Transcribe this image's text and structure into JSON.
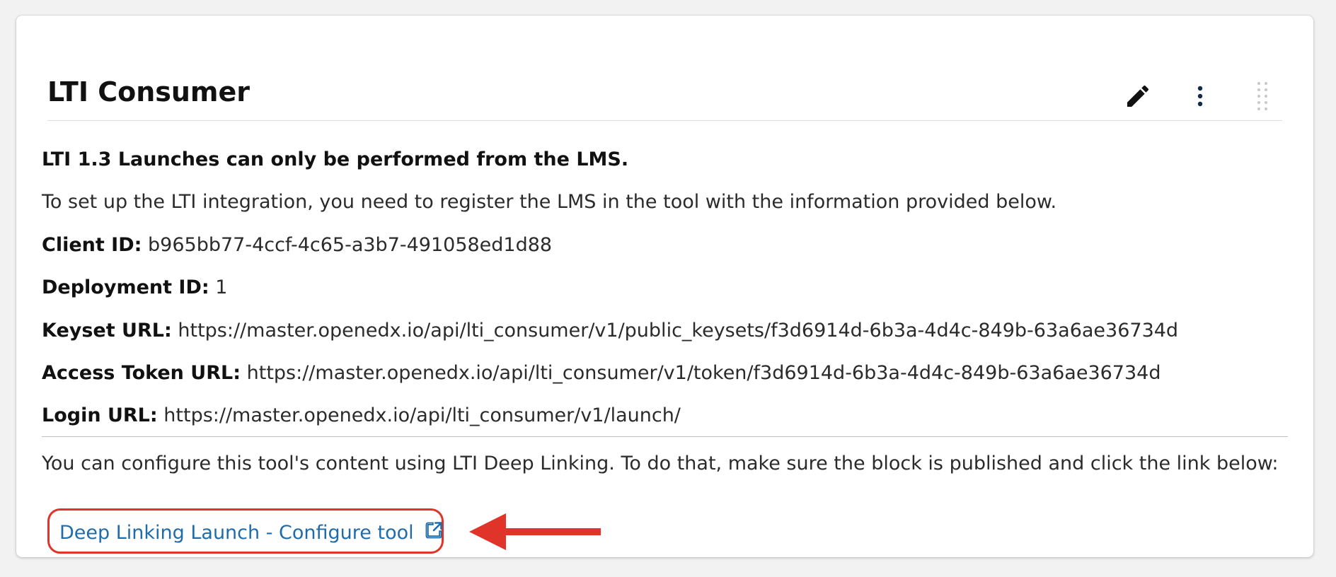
{
  "header": {
    "title": "LTI Consumer",
    "icons": [
      "edit-icon",
      "more-vert-icon",
      "drag-handle-icon"
    ]
  },
  "content": {
    "heading": "LTI 1.3 Launches can only be performed from the LMS.",
    "intro": "To set up the LTI integration, you need to register the LMS in the tool with the information provided below.",
    "fields": [
      {
        "label": "Client ID:",
        "value": "b965bb77-4ccf-4c65-a3b7-491058ed1d88"
      },
      {
        "label": "Deployment ID:",
        "value": "1"
      },
      {
        "label": "Keyset URL:",
        "value": "https://master.openedx.io/api/lti_consumer/v1/public_keysets/f3d6914d-6b3a-4d4c-849b-63a6ae36734d"
      },
      {
        "label": "Access Token URL:",
        "value": "https://master.openedx.io/api/lti_consumer/v1/token/f3d6914d-6b3a-4d4c-849b-63a6ae36734d"
      },
      {
        "label": "Login URL:",
        "value": "https://master.openedx.io/api/lti_consumer/v1/launch/"
      }
    ],
    "deep_linking_text": "You can configure this tool's content using LTI Deep Linking. To do that, make sure the block is published and click the link below:",
    "deep_link_label": "Deep Linking Launch - Configure tool"
  },
  "colors": {
    "link": "#1f6ca8",
    "annotation": "#e0342a",
    "text": "#2b2b2b"
  }
}
